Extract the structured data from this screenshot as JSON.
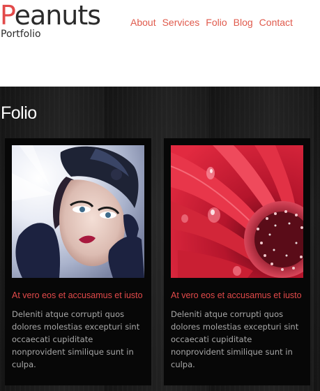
{
  "brand": {
    "initial": "P",
    "rest": "eanuts",
    "tagline": "Portfolio",
    "accent_color": "#e24a4a"
  },
  "nav": {
    "items": [
      "About",
      "Services",
      "Folio",
      "Blog",
      "Contact"
    ]
  },
  "folio": {
    "title": "Folio",
    "cards": [
      {
        "image": "woman-portrait-with-hat-photo",
        "heading": "At vero eos et accusamus et iusto",
        "text": "Deleniti atque corrupti quos dolores molestias excepturi sint occaecati cupiditate nonprovident similique sunt in culpa."
      },
      {
        "image": "red-gerbera-flower-photo",
        "heading": "At vero eos et accusamus et iusto",
        "text": "Deleniti atque corrupti quos dolores molestias excepturi sint occaecati cupiditate nonprovident similique sunt in culpa."
      }
    ]
  }
}
